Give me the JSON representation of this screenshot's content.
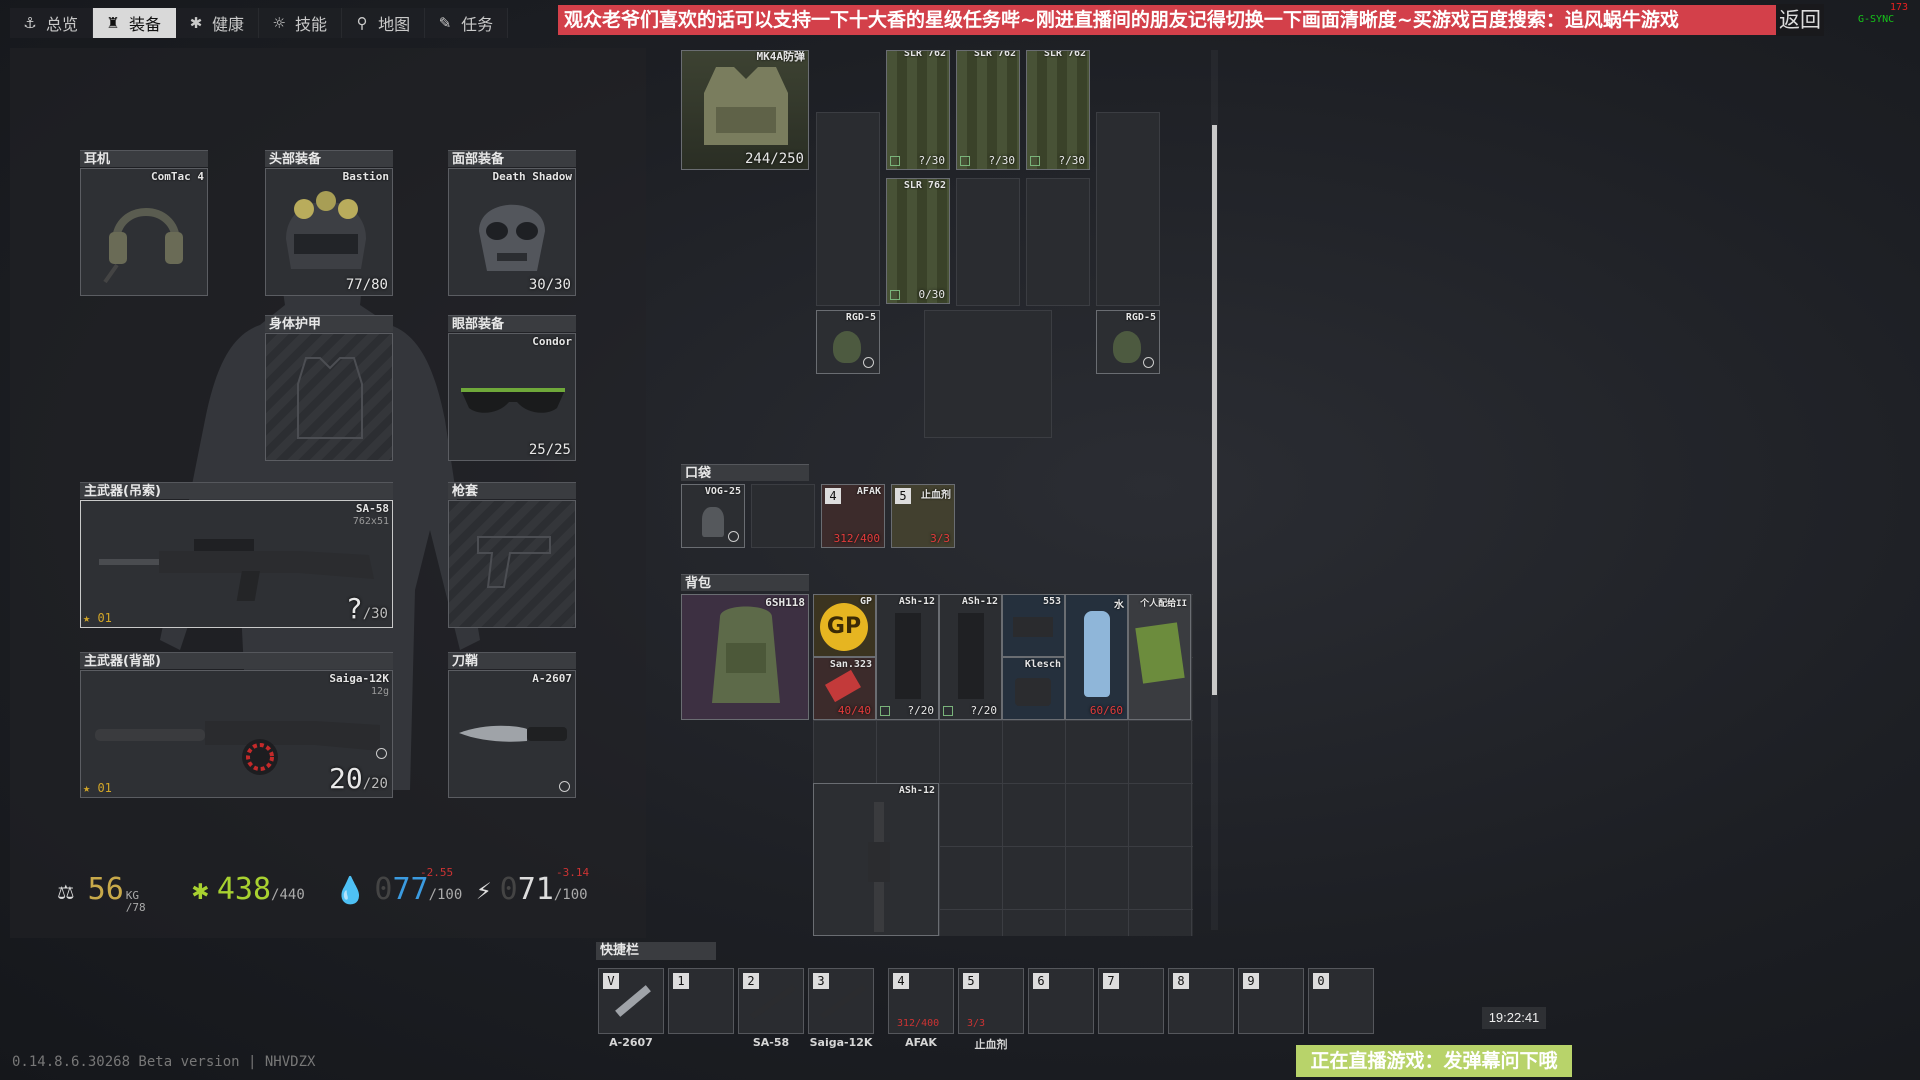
{
  "nav": {
    "tabs": [
      {
        "label": "总览",
        "icon": "anchor-icon"
      },
      {
        "label": "装备",
        "icon": "hanger-icon"
      },
      {
        "label": "健康",
        "icon": "health-icon"
      },
      {
        "label": "技能",
        "icon": "skills-icon"
      },
      {
        "label": "地图",
        "icon": "map-pin-icon"
      },
      {
        "label": "任务",
        "icon": "task-icon"
      }
    ],
    "active": "装备"
  },
  "overlay": {
    "banner": "观众老爷们喜欢的话可以支持一下十大香的星级任务哔~刚进直播间的朋友记得切换一下画面清晰度~买游戏百度搜索：追风蜗牛游戏",
    "return_label": "返回",
    "gsync": "G-SYNC",
    "fps": "173"
  },
  "equipment": {
    "earpiece": {
      "header": "耳机",
      "name": "ComTac 4"
    },
    "headwear": {
      "header": "头部装备",
      "name": "Bastion",
      "durability": "77/80"
    },
    "face_cover": {
      "header": "面部装备",
      "name": "Death Shadow",
      "durability": "30/30"
    },
    "body_armor": {
      "header": "身体护甲"
    },
    "eyewear": {
      "header": "眼部装备",
      "name": "Condor",
      "durability": "25/25"
    },
    "primary_sling": {
      "header": "主武器(吊索)",
      "name": "SA-58",
      "caliber": "762x51",
      "ammo": "?",
      "ammo_max": "/30",
      "tag": "01"
    },
    "holster": {
      "header": "枪套"
    },
    "primary_back": {
      "header": "主武器(背部)",
      "name": "Saiga-12K",
      "caliber": "12g",
      "ammo": "20",
      "ammo_max": "/20",
      "tag": "01"
    },
    "scabbard": {
      "header": "刀鞘",
      "name": "A-2607"
    }
  },
  "stats": {
    "weight": "56",
    "weight_unit": "KG",
    "weight_max": "/78",
    "health": "438",
    "health_max": "/440",
    "hydration": "77",
    "hydration_ghost": "0",
    "hydration_max": "/100",
    "hydration_delta": "-2.55",
    "energy": "71",
    "energy_ghost": "0",
    "energy_max": "/100",
    "energy_delta": "-3.14"
  },
  "rig": {
    "vest": {
      "name": "MK4A防弹",
      "durability": "244/250"
    },
    "mags": [
      {
        "name": "SLR 762",
        "count": "?/30"
      },
      {
        "name": "SLR 762",
        "count": "?/30"
      },
      {
        "name": "SLR 762",
        "count": "?/30"
      },
      {
        "name": "SLR 762",
        "count": "0/30"
      }
    ],
    "grenades": [
      {
        "name": "RGD-5"
      },
      {
        "name": "RGD-5"
      }
    ]
  },
  "pockets": {
    "header": "口袋",
    "items": [
      {
        "name": "VOG-25"
      },
      {
        "name": "AFAK",
        "count": "312/400",
        "slot": "4"
      },
      {
        "name": "止血剂",
        "count": "3/3",
        "slot": "5"
      }
    ]
  },
  "backpack": {
    "header": "背包",
    "bag": {
      "name": "6SH118"
    },
    "items": [
      {
        "name": "GP",
        "label": "GP"
      },
      {
        "name": "ASh-12",
        "count": "?/20"
      },
      {
        "name": "ASh-12",
        "count": "?/20"
      },
      {
        "name": "553"
      },
      {
        "name": "水",
        "count": "60/60"
      },
      {
        "name": "个人配给II"
      },
      {
        "name": "San.323",
        "count": "40/40"
      },
      {
        "name": "Klesch"
      },
      {
        "name": "ASh-12"
      }
    ]
  },
  "quickbar": {
    "header": "快捷栏",
    "slots": [
      {
        "key": "V",
        "label": "A-2607"
      },
      {
        "key": "1",
        "label": ""
      },
      {
        "key": "2",
        "label": "SA-58"
      },
      {
        "key": "3",
        "label": "Saiga-12K"
      },
      {
        "key": "4",
        "label": "AFAK",
        "count": "312/400"
      },
      {
        "key": "5",
        "label": "止血剂",
        "count": "3/3"
      },
      {
        "key": "6",
        "label": ""
      },
      {
        "key": "7",
        "label": ""
      },
      {
        "key": "8",
        "label": ""
      },
      {
        "key": "9",
        "label": ""
      },
      {
        "key": "0",
        "label": ""
      }
    ]
  },
  "footer": {
    "clock": "19:22:41",
    "version": "0.14.8.6.30268 Beta version | NHVDZX",
    "live_banner": "正在直播游戏：发弹幕问下哦"
  }
}
